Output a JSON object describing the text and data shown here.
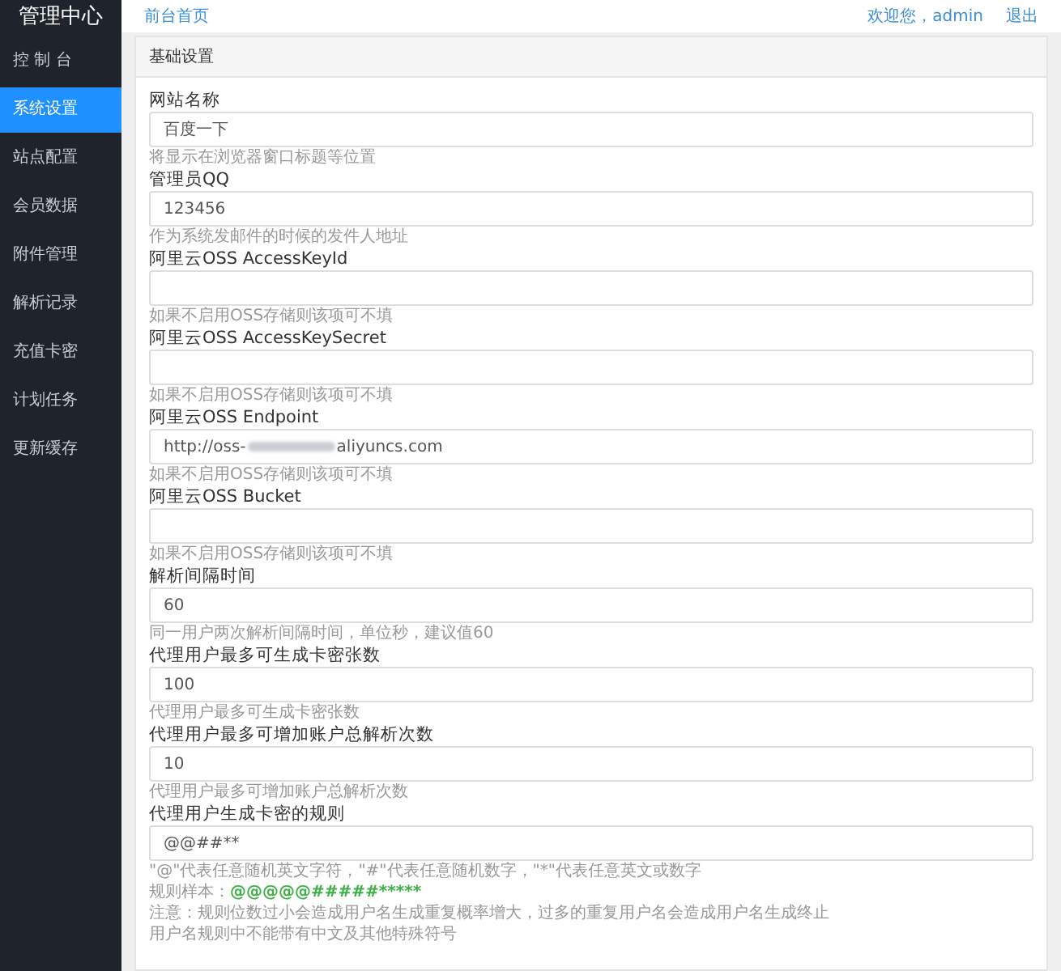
{
  "sidebar": {
    "title": "管理中心",
    "items": [
      {
        "label": "控 制 台",
        "selected": false
      },
      {
        "label": "系统设置",
        "selected": true
      },
      {
        "label": "站点配置",
        "selected": false
      },
      {
        "label": "会员数据",
        "selected": false
      },
      {
        "label": "附件管理",
        "selected": false
      },
      {
        "label": "解析记录",
        "selected": false
      },
      {
        "label": "充值卡密",
        "selected": false
      },
      {
        "label": "计划任务",
        "selected": false
      },
      {
        "label": "更新缓存",
        "selected": false
      }
    ]
  },
  "topbar": {
    "home_link": "前台首页",
    "welcome": "欢迎您，admin",
    "logout": "退出"
  },
  "panel": {
    "title": "基础设置",
    "fields": [
      {
        "kind": "text",
        "label": "网站名称",
        "value": "百度一下",
        "hint": "将显示在浏览器窗口标题等位置"
      },
      {
        "kind": "text",
        "label": "管理员QQ",
        "value": "123456",
        "hint": "作为系统发邮件的时候的发件人地址"
      },
      {
        "kind": "text",
        "label": "阿里云OSS AccessKeyId",
        "hint": "如果不启用OSS存储则该项可不填"
      },
      {
        "kind": "text",
        "label": "阿里云OSS AccessKeySecret",
        "hint": "如果不启用OSS存储则该项可不填"
      },
      {
        "kind": "redacted",
        "label": "阿里云OSS Endpoint",
        "value_prefix": "http://oss-",
        "value_suffix": "aliyuncs.com",
        "hint": "如果不启用OSS存储则该项可不填"
      },
      {
        "kind": "text",
        "label": "阿里云OSS Bucket",
        "hint": "如果不启用OSS存储则该项可不填"
      },
      {
        "kind": "text",
        "label": "解析间隔时间",
        "value": "60",
        "hint": "同一用户两次解析间隔时间，单位秒，建议值60"
      },
      {
        "kind": "text",
        "label": "代理用户最多可生成卡密张数",
        "value": "100",
        "hint": "代理用户最多可生成卡密张数"
      },
      {
        "kind": "text",
        "label": "代理用户最多可增加账户总解析次数",
        "value": "10",
        "hint": "代理用户最多可增加账户总解析次数"
      },
      {
        "kind": "text",
        "label": "代理用户生成卡密的规则",
        "value": "@@##**",
        "notes": [
          {
            "kind": "text",
            "text": "\"@\"代表任意随机英文字符，\"#\"代表任意随机数字，\"*\"代表任意英文或数字"
          },
          {
            "kind": "sample",
            "text": "规则样本：",
            "sample": "@@@@@#####*****"
          },
          {
            "kind": "text",
            "text": "注意：规则位数过小会造成用户名生成重复概率增大，过多的重复用户名会造成用户名生成终止"
          },
          {
            "kind": "text",
            "text": "用户名规则中不能带有中文及其他特殊符号"
          }
        ]
      }
    ]
  }
}
